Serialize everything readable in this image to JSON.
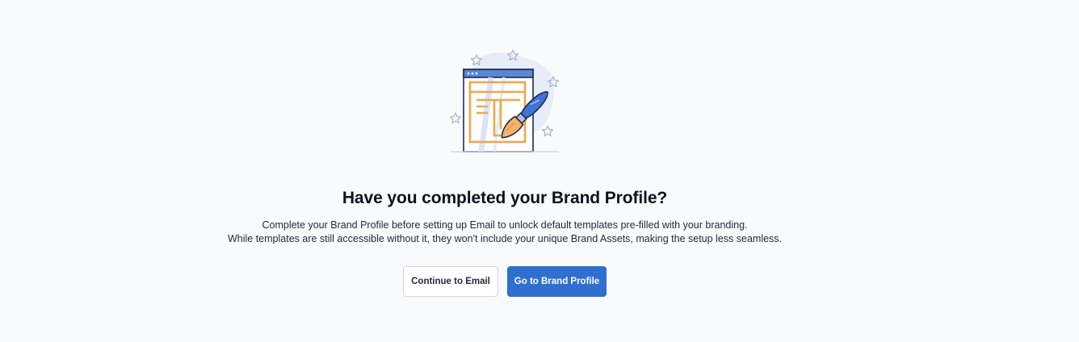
{
  "prompt": {
    "title": "Have you completed your Brand Profile?",
    "description_line_1": "Complete your Brand Profile before setting up Email to unlock default templates pre-filled with your branding.",
    "description_line_2": "While templates are still accessible without it, they won't include your unique Brand Assets, making the setup less seamless."
  },
  "actions": {
    "continue_label": "Continue to Email",
    "go_label": "Go to Brand Profile"
  },
  "illustration": {
    "icon": "brand-template-paintbrush-icon",
    "colors": {
      "blob": "#e6ecf8",
      "window_header": "#5b86d8",
      "outline": "#1f2b4d",
      "template_lines": "#f2a54a",
      "brush_handle": "#3d74d6",
      "brush_tip": "#f6b26b",
      "stars": "#a9b4c8"
    }
  },
  "colors": {
    "background": "#f8fafc",
    "primary": "#2f6fd0",
    "text": "#0b1220"
  }
}
